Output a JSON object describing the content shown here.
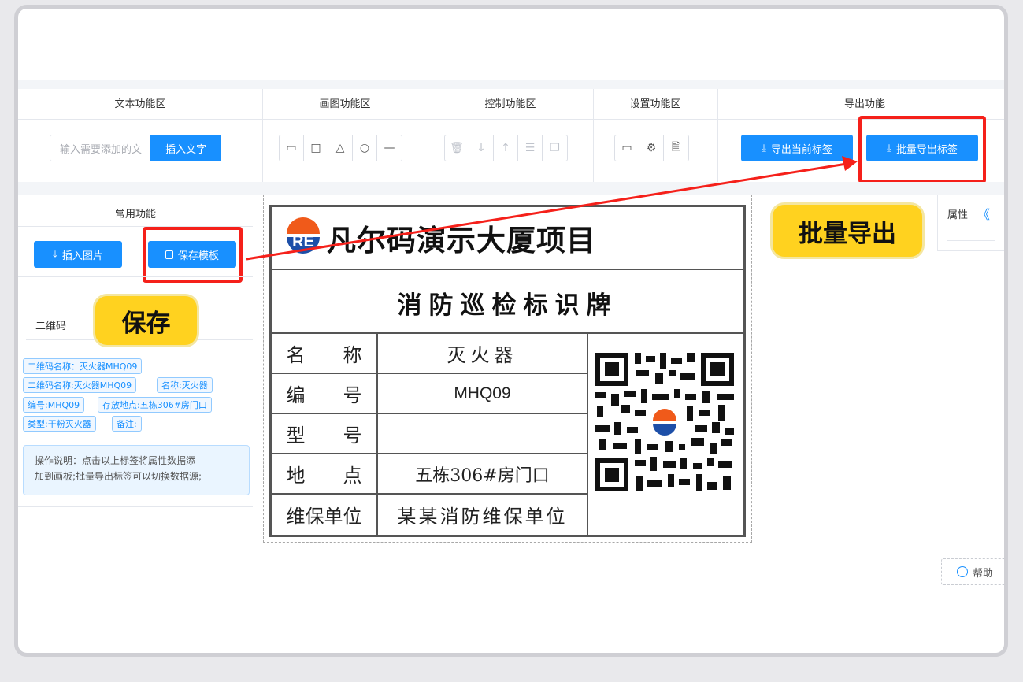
{
  "toolbar": {
    "sections": {
      "text": "文本功能区",
      "draw": "画图功能区",
      "control": "控制功能区",
      "settings": "设置功能区",
      "export": "导出功能"
    },
    "text_input_placeholder": "输入需要添加的文",
    "insert_text_button": "插入文字",
    "draw_tools": [
      "▭",
      "□",
      "△",
      "○",
      "—"
    ],
    "control_tools": [
      "🗑",
      "↓",
      "↑",
      "☰",
      "❐"
    ],
    "settings_tools": [
      "▭",
      "⚙",
      "🗎"
    ],
    "export_current_button": "导出当前标签",
    "export_batch_button": "批量导出标签",
    "upload_glyph": "⤓"
  },
  "left_panel": {
    "common_title": "常用功能",
    "insert_image_button": "插入图片",
    "save_template_button": "保存模板",
    "qr_label": "二维码",
    "tags": [
      "二维码名称：灭火器MHQ09",
      "二维码名称:灭火器MHQ09",
      "名称:灭火器",
      "编号:MHQ09",
      "存放地点:五栋306#房门口",
      "类型:干粉灭火器",
      "备注:"
    ],
    "instructions": [
      "操作说明：点击以上标签将属性数据添",
      "加到画板;批量导出标签可以切换数据源;"
    ]
  },
  "annotations": {
    "save_badge": "保存",
    "batch_export_badge": "批量导出"
  },
  "label_card": {
    "title": "凡尔码演示大厦项目",
    "logo_text": "RE",
    "subtitle": "消防巡检标识牌",
    "rows": [
      {
        "key": "名　　称",
        "value": "灭火器"
      },
      {
        "key": "编　　号",
        "value": "MHQ09"
      },
      {
        "key": "型　　号",
        "value": ""
      },
      {
        "key": "地　　点",
        "value": "五栋306#房门口"
      },
      {
        "key": "维保单位",
        "value": "某某消防维保单位"
      }
    ]
  },
  "right_panel": {
    "properties_title": "属性",
    "collapse_glyph": "《"
  },
  "help_button": "帮助"
}
